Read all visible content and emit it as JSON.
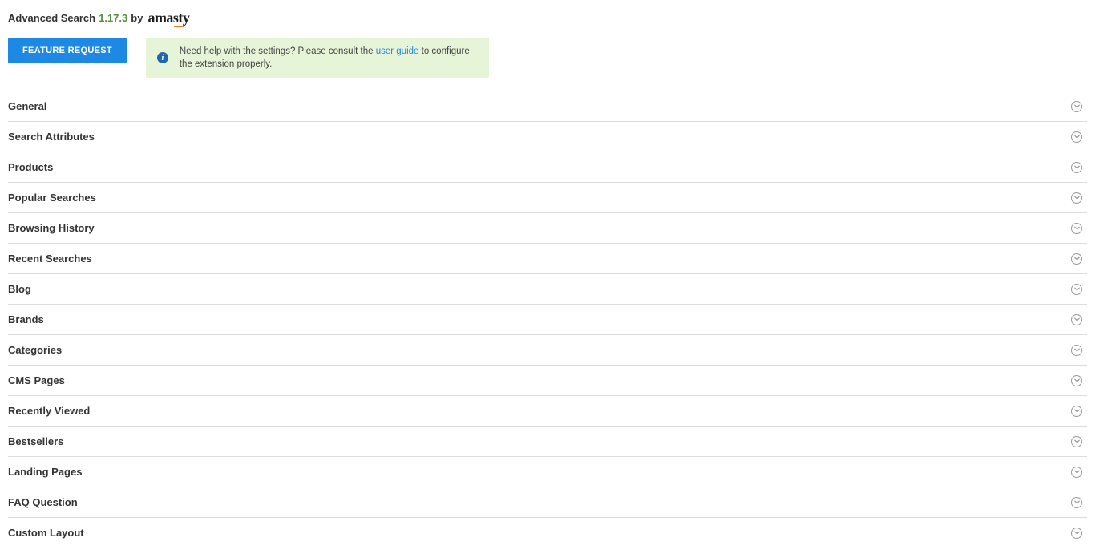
{
  "header": {
    "module_name": "Advanced Search",
    "version": "1.17.3",
    "by_text": "by",
    "brand": "amasty"
  },
  "actions": {
    "feature_request_label": "FEATURE REQUEST"
  },
  "info_banner": {
    "text_before": "Need help with the settings? Please consult the ",
    "link_text": "user guide",
    "text_after": " to configure the extension properly."
  },
  "sections": [
    {
      "label": "General"
    },
    {
      "label": "Search Attributes"
    },
    {
      "label": "Products"
    },
    {
      "label": "Popular Searches"
    },
    {
      "label": "Browsing History"
    },
    {
      "label": "Recent Searches"
    },
    {
      "label": "Blog"
    },
    {
      "label": "Brands"
    },
    {
      "label": "Categories"
    },
    {
      "label": "CMS Pages"
    },
    {
      "label": "Recently Viewed"
    },
    {
      "label": "Bestsellers"
    },
    {
      "label": "Landing Pages"
    },
    {
      "label": "FAQ Question"
    },
    {
      "label": "Custom Layout"
    }
  ]
}
